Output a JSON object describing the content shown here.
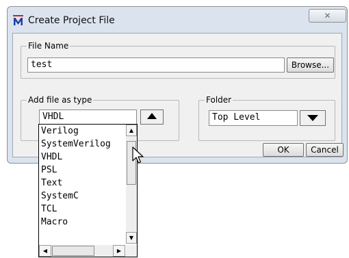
{
  "window": {
    "title": "Create Project File",
    "close_glyph": "✕",
    "icon": "modelsim-m-icon"
  },
  "file_name": {
    "group_label": "File Name",
    "value": "test",
    "browse_label": "Browse..."
  },
  "add_file_type": {
    "group_label": "Add file as type",
    "selected": "VHDL",
    "options": [
      "Verilog",
      "SystemVerilog",
      "VHDL",
      "PSL",
      "Text",
      "SystemC",
      "TCL",
      "Macro"
    ]
  },
  "folder": {
    "group_label": "Folder",
    "selected": "Top Level"
  },
  "buttons": {
    "ok": "OK",
    "cancel": "Cancel"
  },
  "scrollbar_glyphs": {
    "up": "▲",
    "down": "▼",
    "left": "◀",
    "right": "▶"
  },
  "colors": {
    "frame": "#dbe4ee",
    "client": "#f0f0f0",
    "logo_blue": "#1f3fa6"
  }
}
